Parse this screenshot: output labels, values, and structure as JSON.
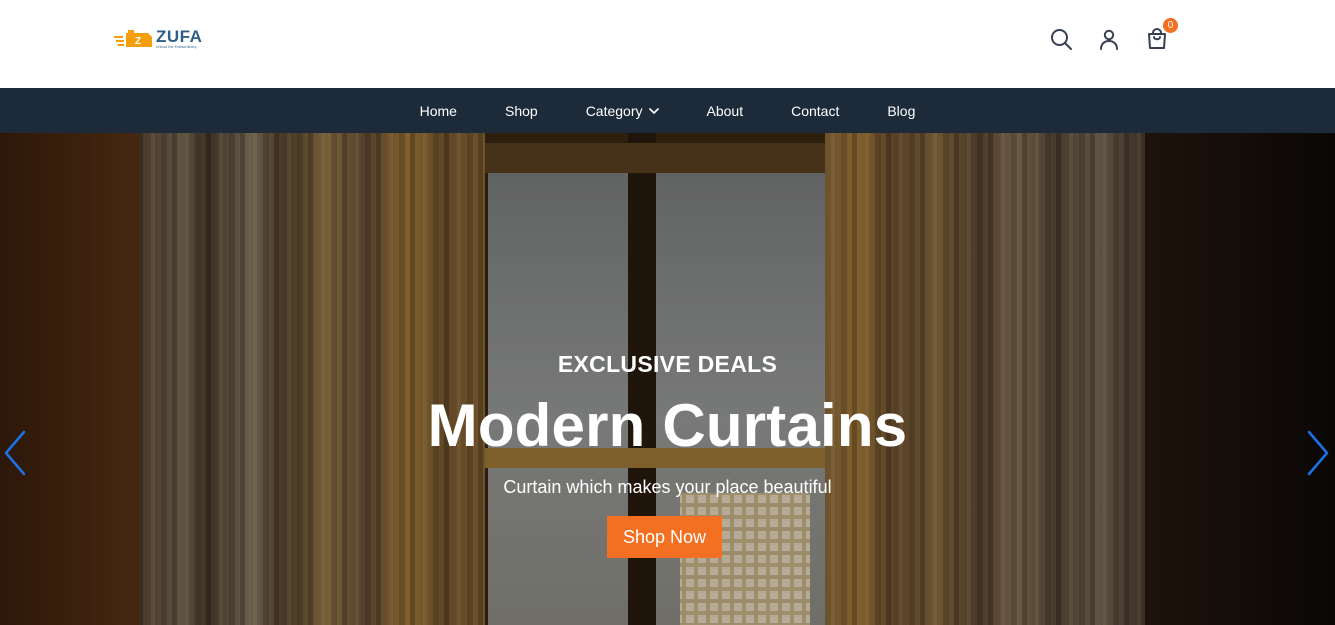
{
  "brand": {
    "name": "ZUFA",
    "tagline": "Unlock the Extraordinary",
    "colors": {
      "primary": "#2f5f86",
      "accent": "#f59e0b"
    }
  },
  "header": {
    "icons": [
      "search-icon",
      "user-icon",
      "shopping-bag-icon"
    ],
    "cart_count": "0"
  },
  "nav": {
    "items": [
      {
        "label": "Home"
      },
      {
        "label": "Shop"
      },
      {
        "label": "Category",
        "has_dropdown": true
      },
      {
        "label": "About"
      },
      {
        "label": "Contact"
      },
      {
        "label": "Blog"
      }
    ],
    "background": "#1d2a3a"
  },
  "hero": {
    "eyebrow": "EXCLUSIVE DEALS",
    "title": "Modern Curtains",
    "subtitle": "Curtain which makes your place beautiful",
    "cta_label": "Shop Now",
    "cta_color": "#f36f21",
    "arrow_color": "#1a73e8",
    "controls": [
      "chevron-left-icon",
      "chevron-right-icon"
    ]
  }
}
